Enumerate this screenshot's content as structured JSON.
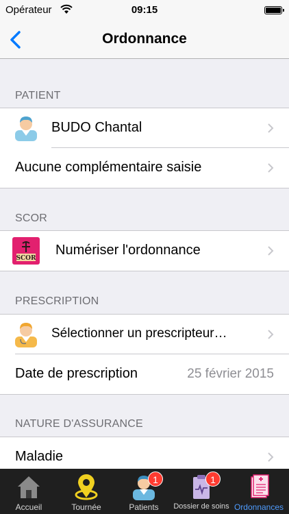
{
  "status_bar": {
    "carrier": "Opérateur",
    "time": "09:15"
  },
  "nav": {
    "title": "Ordonnance"
  },
  "sections": {
    "patient": {
      "header": "PATIENT",
      "name": "BUDO Chantal",
      "complementary": "Aucune complémentaire saisie"
    },
    "scor": {
      "header": "SCOR",
      "scan_label": "Numériser l'ordonnance",
      "logo_text": "SCOR"
    },
    "prescription": {
      "header": "PRESCRIPTION",
      "prescriber_label": "Sélectionner un prescripteur…",
      "date_label": "Date de prescription",
      "date_value": "25 février 2015"
    },
    "assurance": {
      "header": "NATURE D'ASSURANCE",
      "type_label": "Maladie"
    }
  },
  "tabs": [
    {
      "label": "Accueil",
      "icon": "home-icon"
    },
    {
      "label": "Tournée",
      "icon": "map-pin-icon"
    },
    {
      "label": "Patients",
      "icon": "patient-icon",
      "badge": "1"
    },
    {
      "label": "Dossier de soins",
      "icon": "clipboard-icon",
      "badge": "1"
    },
    {
      "label": "Ordonnances",
      "icon": "prescription-icon",
      "active": true
    }
  ],
  "colors": {
    "accent": "#007aff",
    "tab_active": "#4f9cff",
    "badge": "#ff3b30",
    "background": "#efeff4"
  }
}
